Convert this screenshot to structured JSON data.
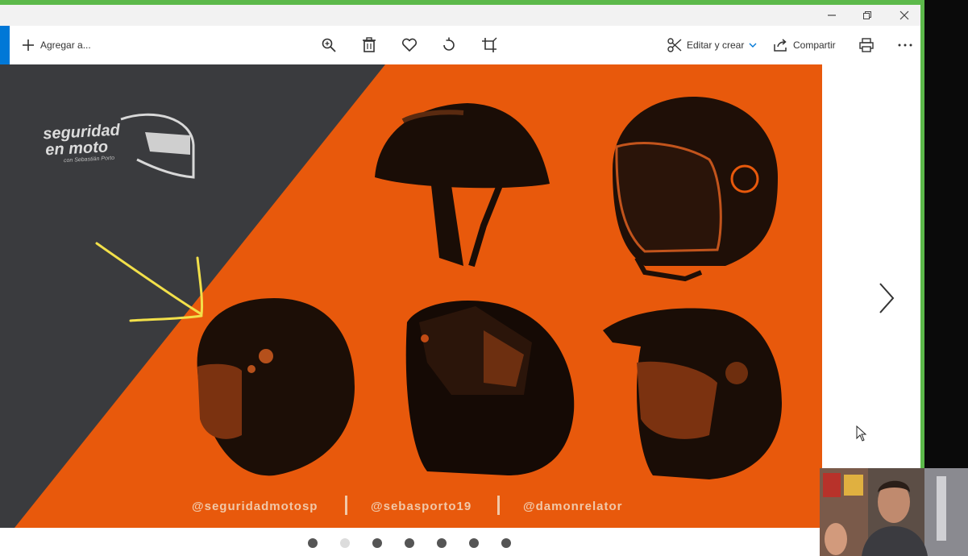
{
  "toolbar": {
    "add_label": "Agregar a...",
    "edit_label": "Editar y crear",
    "share_label": "Compartir"
  },
  "photo": {
    "logo_line1": "seguridad",
    "logo_line2": "en moto",
    "logo_sub": "con Sebastián Porto",
    "handles": [
      "@seguridadmotosp",
      "@sebasporto19",
      "@damonrelator"
    ]
  },
  "carousel": {
    "dot_count": 7,
    "active_index": 1
  },
  "colors": {
    "accent": "#0078d7",
    "orange": "#e8590c",
    "dark_panel": "#3a3b3e",
    "window_border": "#5cb94a"
  }
}
